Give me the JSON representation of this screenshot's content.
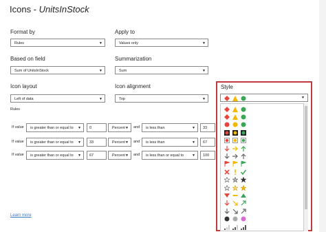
{
  "dialog": {
    "title_prefix": "Icons - ",
    "title_field": "UnitsInStock",
    "format_by": {
      "label": "Format by",
      "value": "Rules"
    },
    "apply_to": {
      "label": "Apply to",
      "value": "Values only"
    },
    "based_on": {
      "label": "Based on field",
      "value": "Sum of UnitsInStock"
    },
    "summarization": {
      "label": "Summarization",
      "value": "Sum"
    },
    "icon_layout": {
      "label": "Icon layout",
      "value": "Left of data"
    },
    "icon_alignment": {
      "label": "Icon alignment",
      "value": "Top"
    },
    "style_label": "Style",
    "rules_label": "Rules",
    "learn_more": "Learn more"
  },
  "rules": [
    {
      "if": "If value",
      "op1": "is greater than or equal to",
      "v1": "0",
      "unit1": "Percent",
      "and": "and",
      "op2": "is less than",
      "v2": "33"
    },
    {
      "if": "If value",
      "op1": "is greater than or equal to",
      "v1": "33",
      "unit1": "Percent",
      "and": "and",
      "op2": "is less than",
      "v2": "67"
    },
    {
      "if": "If value",
      "op1": "is greater than or equal to",
      "v1": "67",
      "unit1": "Percent",
      "and": "and",
      "op2": "is less than or equal to",
      "v2": "100"
    }
  ],
  "style_rows": [
    [
      "red-diamond-icon",
      "yellow-triangle-icon",
      "green-circle-icon"
    ],
    [
      "red-diamond-icon",
      "yellow-triangle-icon",
      "green-circle-icon"
    ],
    [
      "red-circle-icon",
      "yellow-circle-icon",
      "green-circle-icon"
    ],
    [
      "black-box-red-icon",
      "black-box-yellow-icon",
      "black-box-green-icon"
    ],
    [
      "box-red-icon",
      "box-yellow-icon",
      "box-green-icon"
    ],
    [
      "arrow-down-icon",
      "arrow-right-icon",
      "arrow-up-icon"
    ],
    [
      "arrow-down-gray-icon",
      "arrow-right-gray-icon",
      "arrow-up-gray-icon"
    ],
    [
      "flag-red-icon",
      "flag-yellow-icon",
      "flag-green-icon"
    ],
    [
      "red-x-icon",
      "yellow-exclaim-icon",
      "green-check-icon"
    ],
    [
      "star-empty-icon",
      "star-half-icon",
      "star-full-icon"
    ],
    [
      "star-empty-icon",
      "star-half-yellow-icon",
      "star-full-yellow-icon"
    ],
    [
      "triangle-down-red-icon",
      "dash-yellow-icon",
      "triangle-up-green-icon"
    ],
    [
      "arrow-down-red-icon",
      "arrow-diag-down-icon",
      "arrow-diag-up-icon"
    ],
    [
      "arrow-down-gray-icon",
      "arrow-diag-down-gray-icon",
      "arrow-diag-up-gray-icon"
    ],
    [
      "black-circle-icon",
      "gray-circle-icon",
      "pink-circle-icon"
    ],
    [
      "signal-1-icon",
      "signal-2-icon",
      "signal-3-icon"
    ]
  ],
  "colors": {
    "accent_border": "#c0393b",
    "link": "#3a76c3"
  }
}
